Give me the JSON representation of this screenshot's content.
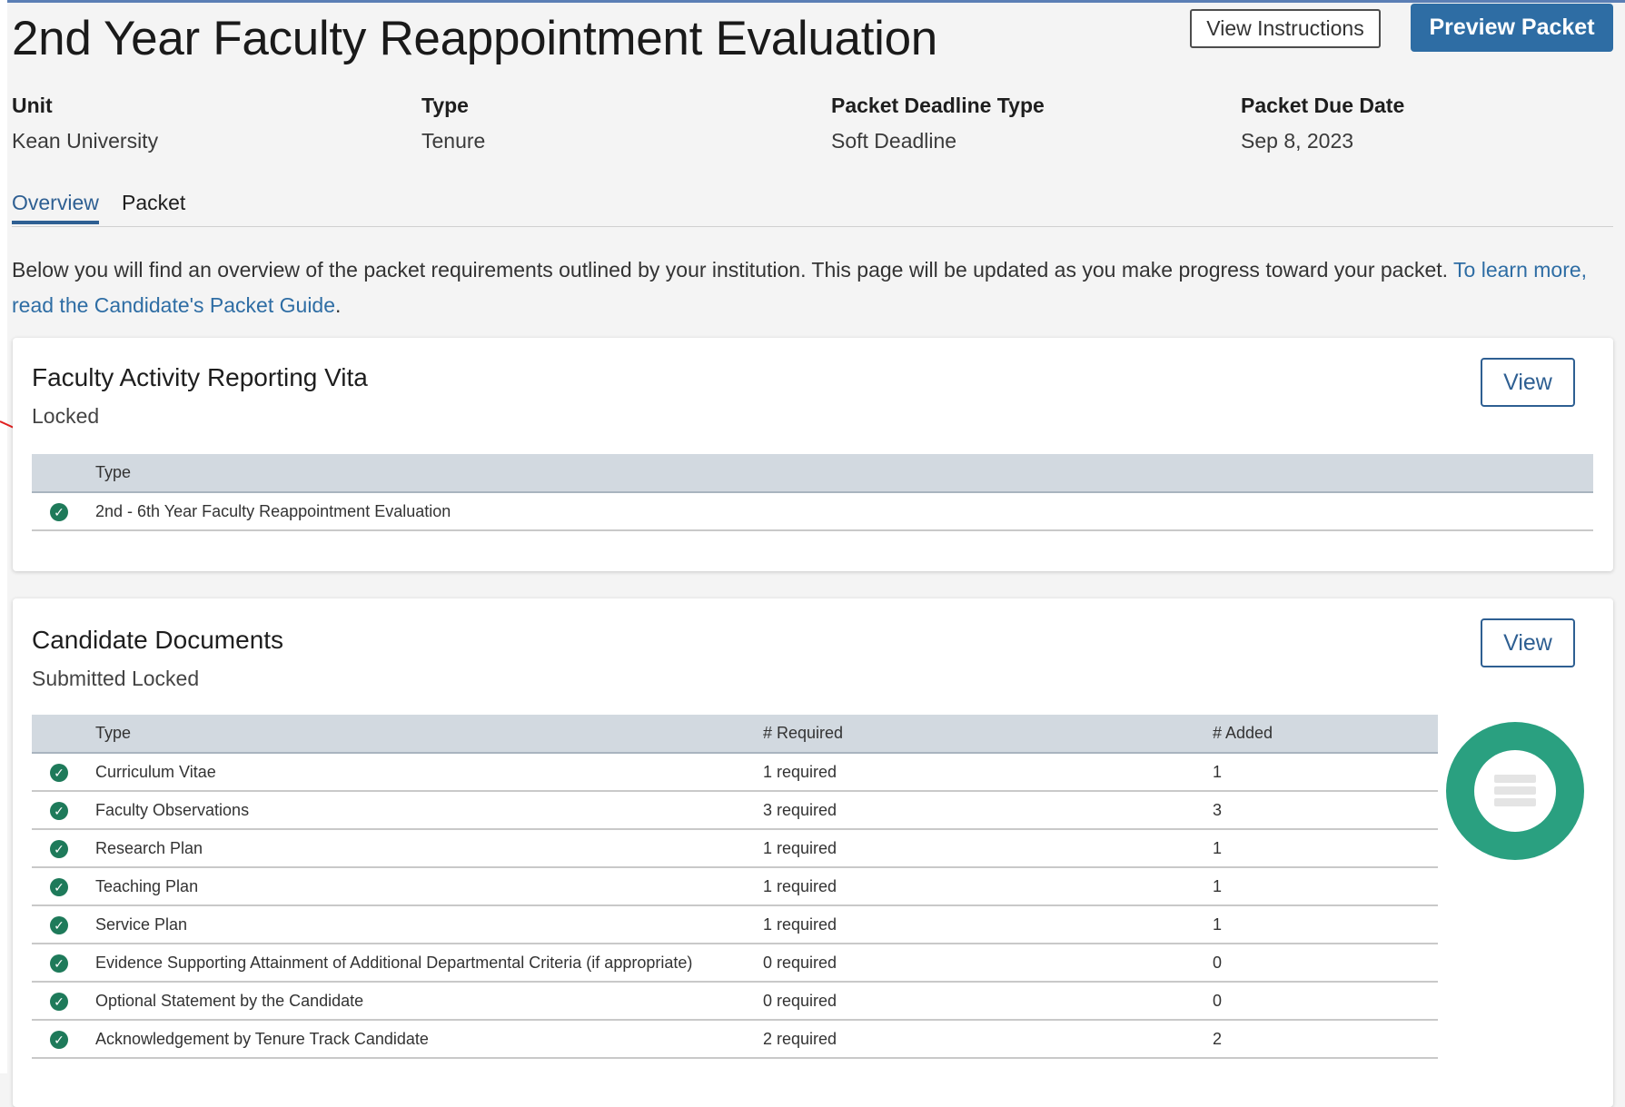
{
  "header": {
    "title": "2nd Year Faculty Reappointment Evaluation",
    "view_instructions_label": "View Instructions",
    "preview_packet_label": "Preview Packet"
  },
  "meta": [
    {
      "label": "Unit",
      "value": "Kean University"
    },
    {
      "label": "Type",
      "value": "Tenure"
    },
    {
      "label": "Packet Deadline Type",
      "value": "Soft Deadline"
    },
    {
      "label": "Packet Due Date",
      "value": "Sep 8, 2023"
    }
  ],
  "tabs": [
    {
      "label": "Overview",
      "active": true
    },
    {
      "label": "Packet",
      "active": false
    }
  ],
  "intro": {
    "text": "Below you will find an overview of the packet requirements outlined by your institution. This page will be updated as you make progress toward your packet.",
    "link": "To learn more, read the Candidate's Packet Guide",
    "trailing": "."
  },
  "colors": {
    "primary": "#2e6da4",
    "success": "#1e7a5a",
    "progress_ring": "#2aa080",
    "table_header": "#d2d9e0",
    "annotation_arrow": "#e02020"
  },
  "far_card": {
    "title": "Faculty Activity Reporting Vita",
    "status": "Locked",
    "view_label": "View",
    "columns": [
      "Type"
    ],
    "rows": [
      {
        "status_icon": "check-circle-icon",
        "type": "2nd - 6th Year Faculty Reappointment Evaluation"
      }
    ]
  },
  "documents_card": {
    "title": "Candidate Documents",
    "status": "Submitted Locked",
    "view_label": "View",
    "progress_icon": "list-icon",
    "columns": [
      "Type",
      "# Required",
      "# Added"
    ],
    "rows": [
      {
        "status_icon": "check-circle-icon",
        "type": "Curriculum Vitae",
        "required": "1 required",
        "added": "1"
      },
      {
        "status_icon": "check-circle-icon",
        "type": "Faculty Observations",
        "required": "3 required",
        "added": "3"
      },
      {
        "status_icon": "check-circle-icon",
        "type": "Research Plan",
        "required": "1 required",
        "added": "1"
      },
      {
        "status_icon": "check-circle-icon",
        "type": "Teaching Plan",
        "required": "1 required",
        "added": "1"
      },
      {
        "status_icon": "check-circle-icon",
        "type": "Service Plan",
        "required": "1 required",
        "added": "1"
      },
      {
        "status_icon": "check-circle-icon",
        "type": "Evidence Supporting Attainment of Additional Departmental Criteria (if appropriate)",
        "required": "0 required",
        "added": "0"
      },
      {
        "status_icon": "check-circle-icon",
        "type": "Optional Statement by the Candidate",
        "required": "0 required",
        "added": "0"
      },
      {
        "status_icon": "check-circle-icon",
        "type": "Acknowledgement by Tenure Track Candidate",
        "required": "2 required",
        "added": "2"
      }
    ]
  }
}
